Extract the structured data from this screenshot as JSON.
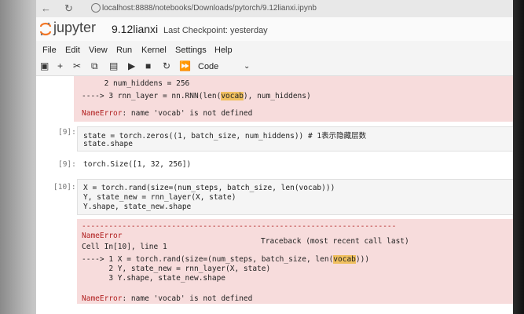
{
  "browser": {
    "url": "localhost:8888/notebooks/Downloads/pytorch/9.12lianxi.ipynb"
  },
  "header": {
    "logo_text": "jupyter",
    "notebook_name": "9.12lianxi",
    "checkpoint": "Last Checkpoint: yesterday"
  },
  "menu": [
    "File",
    "Edit",
    "View",
    "Run",
    "Kernel",
    "Settings",
    "Help"
  ],
  "toolbar": {
    "cell_type": "Code"
  },
  "cells": {
    "err1": {
      "line_a": "     2 num_hiddens = 256",
      "line_b_pre": "----> 3 rnn_layer = nn.RNN(len(",
      "line_b_hl": "vocab",
      "line_b_post": "), num_hiddens)",
      "error_name": "NameError",
      "error_msg": ": name 'vocab' is not defined"
    },
    "c9": {
      "prompt": "[9]:",
      "line1": "state = torch.zeros((1, batch_size, num_hiddens)) # 1表示隐藏层数",
      "line2": "state.shape"
    },
    "o9": {
      "prompt": "[9]:",
      "text": "torch.Size([1, 32, 256])"
    },
    "c10": {
      "prompt": "[10]:",
      "line1": "X = torch.rand(size=(num_steps, batch_size, len(vocab)))",
      "line2": "Y, state_new = rnn_layer(X, state)",
      "line3": "Y.shape, state_new.shape"
    },
    "err10": {
      "dashes": "----------------------------------------------------------------------",
      "error_name": "NameError",
      "traceback": "Traceback (most recent call last)",
      "location": "Cell In[10], line 1",
      "tb1_pre": "----> 1 X = torch.rand(size=(num_steps, batch_size, len(",
      "tb1_hl": "vocab",
      "tb1_post": ")))",
      "tb2": "      2 Y, state_new = rnn_layer(X, state)",
      "tb3": "      3 Y.shape, state_new.shape",
      "final_name": "NameError",
      "final_msg": ": name 'vocab' is not defined"
    }
  }
}
